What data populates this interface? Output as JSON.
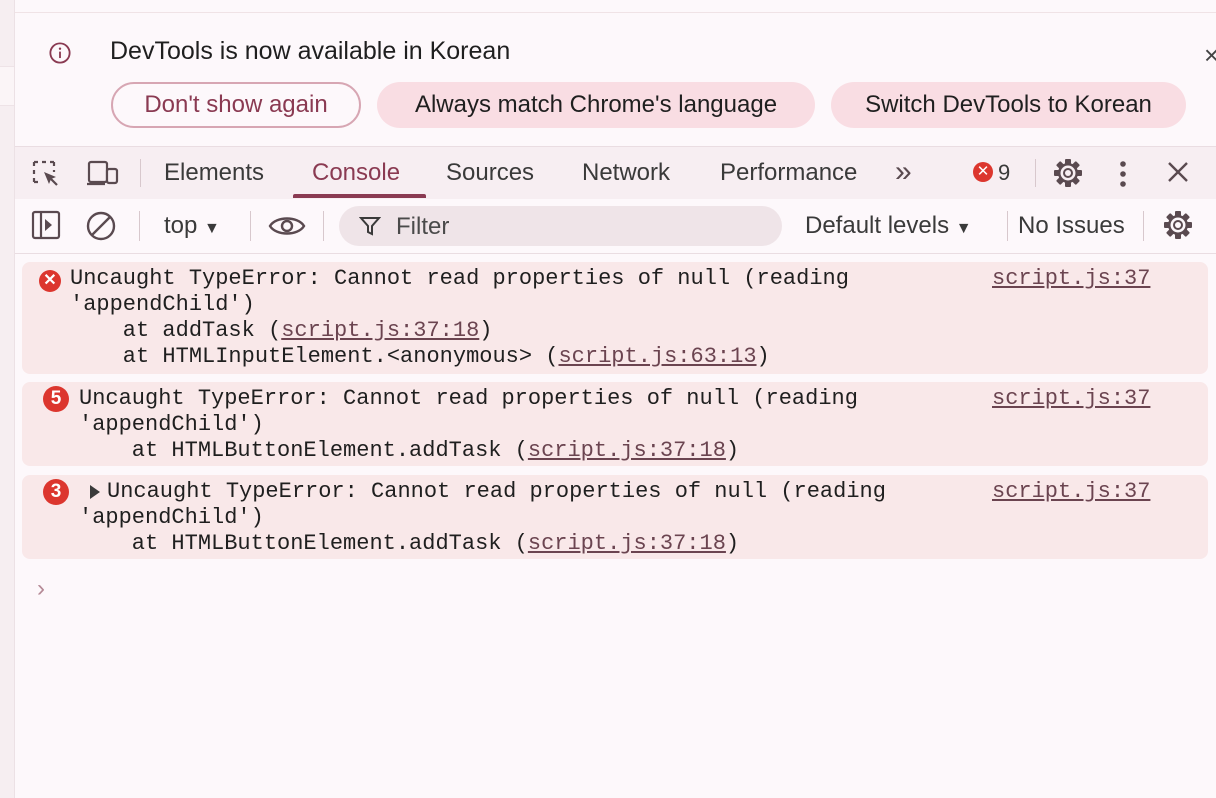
{
  "infobar": {
    "title": "DevTools is now available in Korean",
    "btn_dont_show": "Don't show again",
    "btn_match": "Always match Chrome's language",
    "btn_switch": "Switch DevTools to Korean",
    "close_glyph": "×"
  },
  "toolbar": {
    "tabs": [
      "Elements",
      "Console",
      "Sources",
      "Network",
      "Performance"
    ],
    "active_tab": "Console",
    "more_tabs": "»",
    "error_badge": "✕",
    "error_count": "9"
  },
  "console_toolbar": {
    "context": "top",
    "filter_placeholder": "Filter",
    "levels": "Default levels",
    "issues": "No Issues"
  },
  "messages": [
    {
      "line1": "Uncaught TypeError: Cannot read properties of null (reading",
      "line2": "'appendChild')",
      "stack": [
        {
          "prefix": "    at addTask (",
          "link": "script.js:37:18",
          "suffix": ")"
        },
        {
          "prefix": "    at HTMLInputElement.<anonymous> (",
          "link": "script.js:63:13",
          "suffix": ")"
        }
      ],
      "source": "script.js:37"
    },
    {
      "count": "5",
      "line1": "Uncaught TypeError: Cannot read properties of null (reading",
      "line2": "'appendChild')",
      "stack": [
        {
          "prefix": "    at HTMLButtonElement.addTask (",
          "link": "script.js:37:18",
          "suffix": ")"
        }
      ],
      "source": "script.js:37"
    },
    {
      "count": "3",
      "line1": "Uncaught TypeError: Cannot read properties of null (reading",
      "line2": "'appendChild')",
      "stack": [
        {
          "prefix": "    at HTMLButtonElement.addTask (",
          "link": "script.js:37:18",
          "suffix": ")"
        }
      ],
      "source": "script.js:37"
    }
  ],
  "prompt_glyph": "›",
  "colors": {
    "accent": "#8a3a52",
    "error": "#dc362e",
    "message_bg": "#f9e8e9",
    "pill_bg": "#f9dde3"
  }
}
